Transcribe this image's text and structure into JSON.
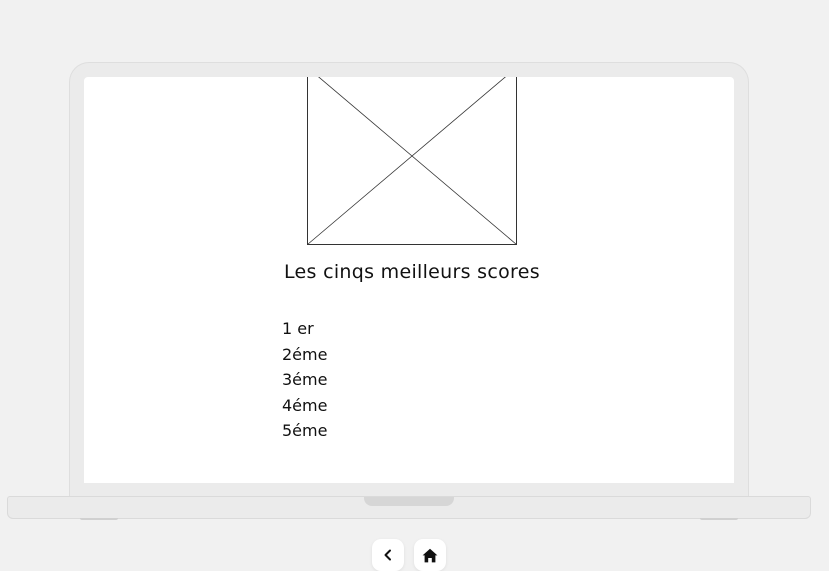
{
  "main": {
    "scores_title": "Les cinqs meilleurs scores",
    "scores": [
      {
        "rank": "1 er"
      },
      {
        "rank": "2éme"
      },
      {
        "rank": "3éme"
      },
      {
        "rank": "4éme"
      },
      {
        "rank": "5éme"
      }
    ]
  },
  "bottom_nav": {
    "back_icon": "chevron-left-icon",
    "home_icon": "home-icon"
  },
  "colors": {
    "background": "#f1f1f1",
    "device_frame": "#ebebeb",
    "screen": "#ffffff",
    "text": "#111111"
  }
}
